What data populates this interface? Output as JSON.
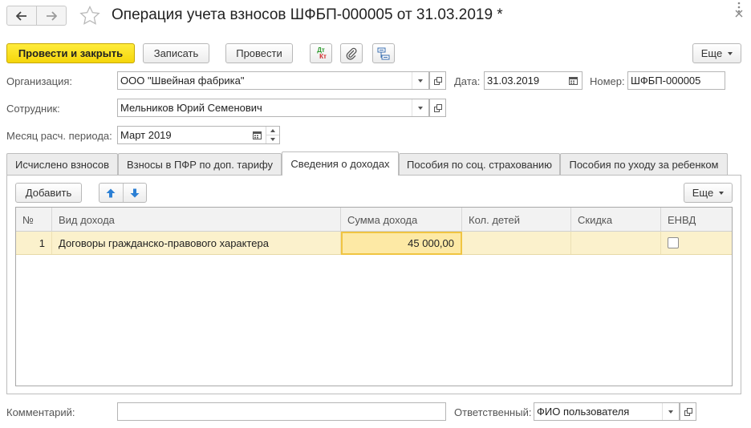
{
  "window": {
    "title": "Операция учета взносов ШФБП-000005 от 31.03.2019 *",
    "more_icon": "kebab-icon",
    "close_icon": "close-icon"
  },
  "toolbar": {
    "post_close": "Провести и закрыть",
    "save": "Записать",
    "post": "Провести",
    "dt_kt_top": "Дт",
    "dt_kt_bottom": "Кт",
    "more": "Еще"
  },
  "form": {
    "org_label": "Организация:",
    "org_value": "ООО \"Швейная фабрика\"",
    "date_label": "Дата:",
    "date_value": "31.03.2019",
    "number_label": "Номер:",
    "number_value": "ШФБП-000005",
    "employee_label": "Сотрудник:",
    "employee_value": "Мельников Юрий Семенович",
    "month_label": "Месяц расч. периода:",
    "month_value": "Март 2019"
  },
  "tabs": [
    {
      "label": "Исчислено взносов",
      "active": false
    },
    {
      "label": "Взносы в ПФР по доп. тарифу",
      "active": false
    },
    {
      "label": "Сведения о доходах",
      "active": true
    },
    {
      "label": "Пособия по соц. страхованию",
      "active": false
    },
    {
      "label": "Пособия по уходу за ребенком",
      "active": false
    }
  ],
  "table_toolbar": {
    "add": "Добавить",
    "more": "Еще"
  },
  "table": {
    "columns": [
      "№",
      "Вид дохода",
      "Сумма дохода",
      "Кол. детей",
      "Скидка",
      "ЕНВД"
    ],
    "rows": [
      {
        "num": "1",
        "income_type": "Договоры гражданско-правового характера",
        "amount": "45 000,00",
        "children": "",
        "discount": "",
        "envd": false
      }
    ]
  },
  "footer": {
    "comment_label": "Комментарий:",
    "comment_value": "",
    "responsible_label": "Ответственный:",
    "responsible_value": "ФИО пользователя"
  },
  "colors": {
    "primary_button": "#f5d60a",
    "selected_row": "#fbf1cc",
    "selected_cell_border": "#f0c442",
    "arrow_blue": "#2b7fd4"
  }
}
